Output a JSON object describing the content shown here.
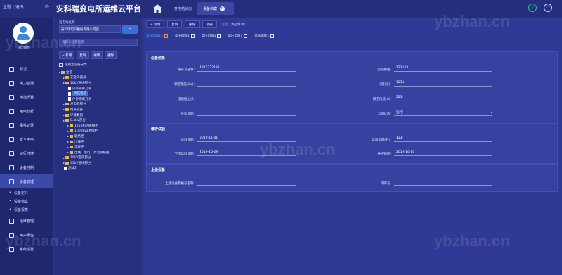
{
  "topbar": {
    "user": "主题 | 退出",
    "title": "安科瑞变电所运维云平台",
    "tabs": [
      "变电站状态",
      "设备档案"
    ]
  },
  "sidebar": {
    "username": "admin",
    "menu": [
      {
        "label": "概况"
      },
      {
        "label": "电力监测"
      },
      {
        "label": "电能质量"
      },
      {
        "label": "用电分析"
      },
      {
        "label": "事件记录"
      },
      {
        "label": "安全用电"
      },
      {
        "label": "运行环境"
      },
      {
        "label": "设备控制"
      },
      {
        "label": "设备管理"
      }
    ],
    "submenu": [
      "设备定义",
      "设备档案",
      "设备报表"
    ],
    "menu2": [
      {
        "label": "运维管理"
      },
      {
        "label": "用户报告"
      },
      {
        "label": "系统设置"
      }
    ]
  },
  "tree": {
    "label": "变电站名称",
    "company": "安科瑞电气股份有限公司变",
    "search_placeholder": "请输入检索内容",
    "actions": [
      "+ 新增",
      "复制",
      "编辑",
      "删除"
    ],
    "hide_unclassified": "隐藏无设备分类",
    "nodes": [
      {
        "text": "全部",
        "level": 0,
        "type": "folder"
      },
      {
        "text": "安全工器具",
        "level": 1,
        "type": "folder"
      },
      {
        "text": "10kV进线部分",
        "level": 1,
        "type": "folder"
      },
      {
        "text": "户外隔离刀闸",
        "level": 2,
        "type": "doc"
      },
      {
        "text": "高压电缆",
        "level": 2,
        "type": "doc",
        "selected": true
      },
      {
        "text": "户外隔离刀闸",
        "level": 2,
        "type": "doc"
      },
      {
        "text": "发电机部分",
        "level": 1,
        "type": "folder"
      },
      {
        "text": "附属设备",
        "level": 1,
        "type": "folder"
      },
      {
        "text": "环境数据",
        "level": 1,
        "type": "folder"
      },
      {
        "text": "0.4kV部分",
        "level": 1,
        "type": "folder"
      },
      {
        "text": "1250KVA进线柜",
        "level": 2,
        "type": "folder"
      },
      {
        "text": "1000kva进线柜",
        "level": 2,
        "type": "folder"
      },
      {
        "text": "联络柜",
        "level": 2,
        "type": "folder"
      },
      {
        "text": "出线柜",
        "level": 2,
        "type": "folder"
      },
      {
        "text": "电容柜",
        "level": 2,
        "type": "folder"
      },
      {
        "text": "出线、发电、高电联络柜",
        "level": 2,
        "type": "folder"
      },
      {
        "text": "10kV室内部分",
        "level": 1,
        "type": "folder"
      },
      {
        "text": "35kV进线部分",
        "level": 1,
        "type": "folder"
      },
      {
        "text": "测试2",
        "level": 1,
        "type": "doc"
      }
    ]
  },
  "main": {
    "toolbar": [
      "+ 新增",
      "复制",
      "删除",
      "保存"
    ],
    "note_prefix": "注意:",
    "note_link": "[为必填项]",
    "device_tabs": [
      "高压电缆12",
      "高压电缆1",
      "高压电缆1",
      "高压电缆1",
      "高压电缆1"
    ],
    "info_title": "设备信息",
    "info": {
      "code_label": "编号及名称:",
      "code_value": "1321232131",
      "model_label": "型号规格:",
      "model_value": "123123",
      "voltage_label": "额定电压(kV):",
      "voltage_value": "",
      "length_label": "长度(米):",
      "length_value": "1231",
      "section_label": "电缆截止点:",
      "section_value": "",
      "current_label": "额定电流(A):",
      "current_value": "223",
      "install_label": "投运日期:",
      "install_value": "",
      "status_label": "当前状态:",
      "status_value": "运行"
    },
    "maint_title": "维护试验",
    "maint": {
      "test_date_label": "试验日期:",
      "test_date_value": "2019-11-01",
      "test_cycle_label": "试验周期(月):",
      "test_cycle_value": "123",
      "next_label": "下次试验日期:",
      "next_value": "2019-10-09",
      "maint_date_label": "维护日期:",
      "maint_date_value": "2019-10-16"
    },
    "parent_title": "上级设备",
    "parent": {
      "parent_label": "上级设备及编号名称:",
      "parent_value": "",
      "sort_label": "排序号:",
      "sort_value": ""
    }
  },
  "watermark": "ybzhan.cn"
}
